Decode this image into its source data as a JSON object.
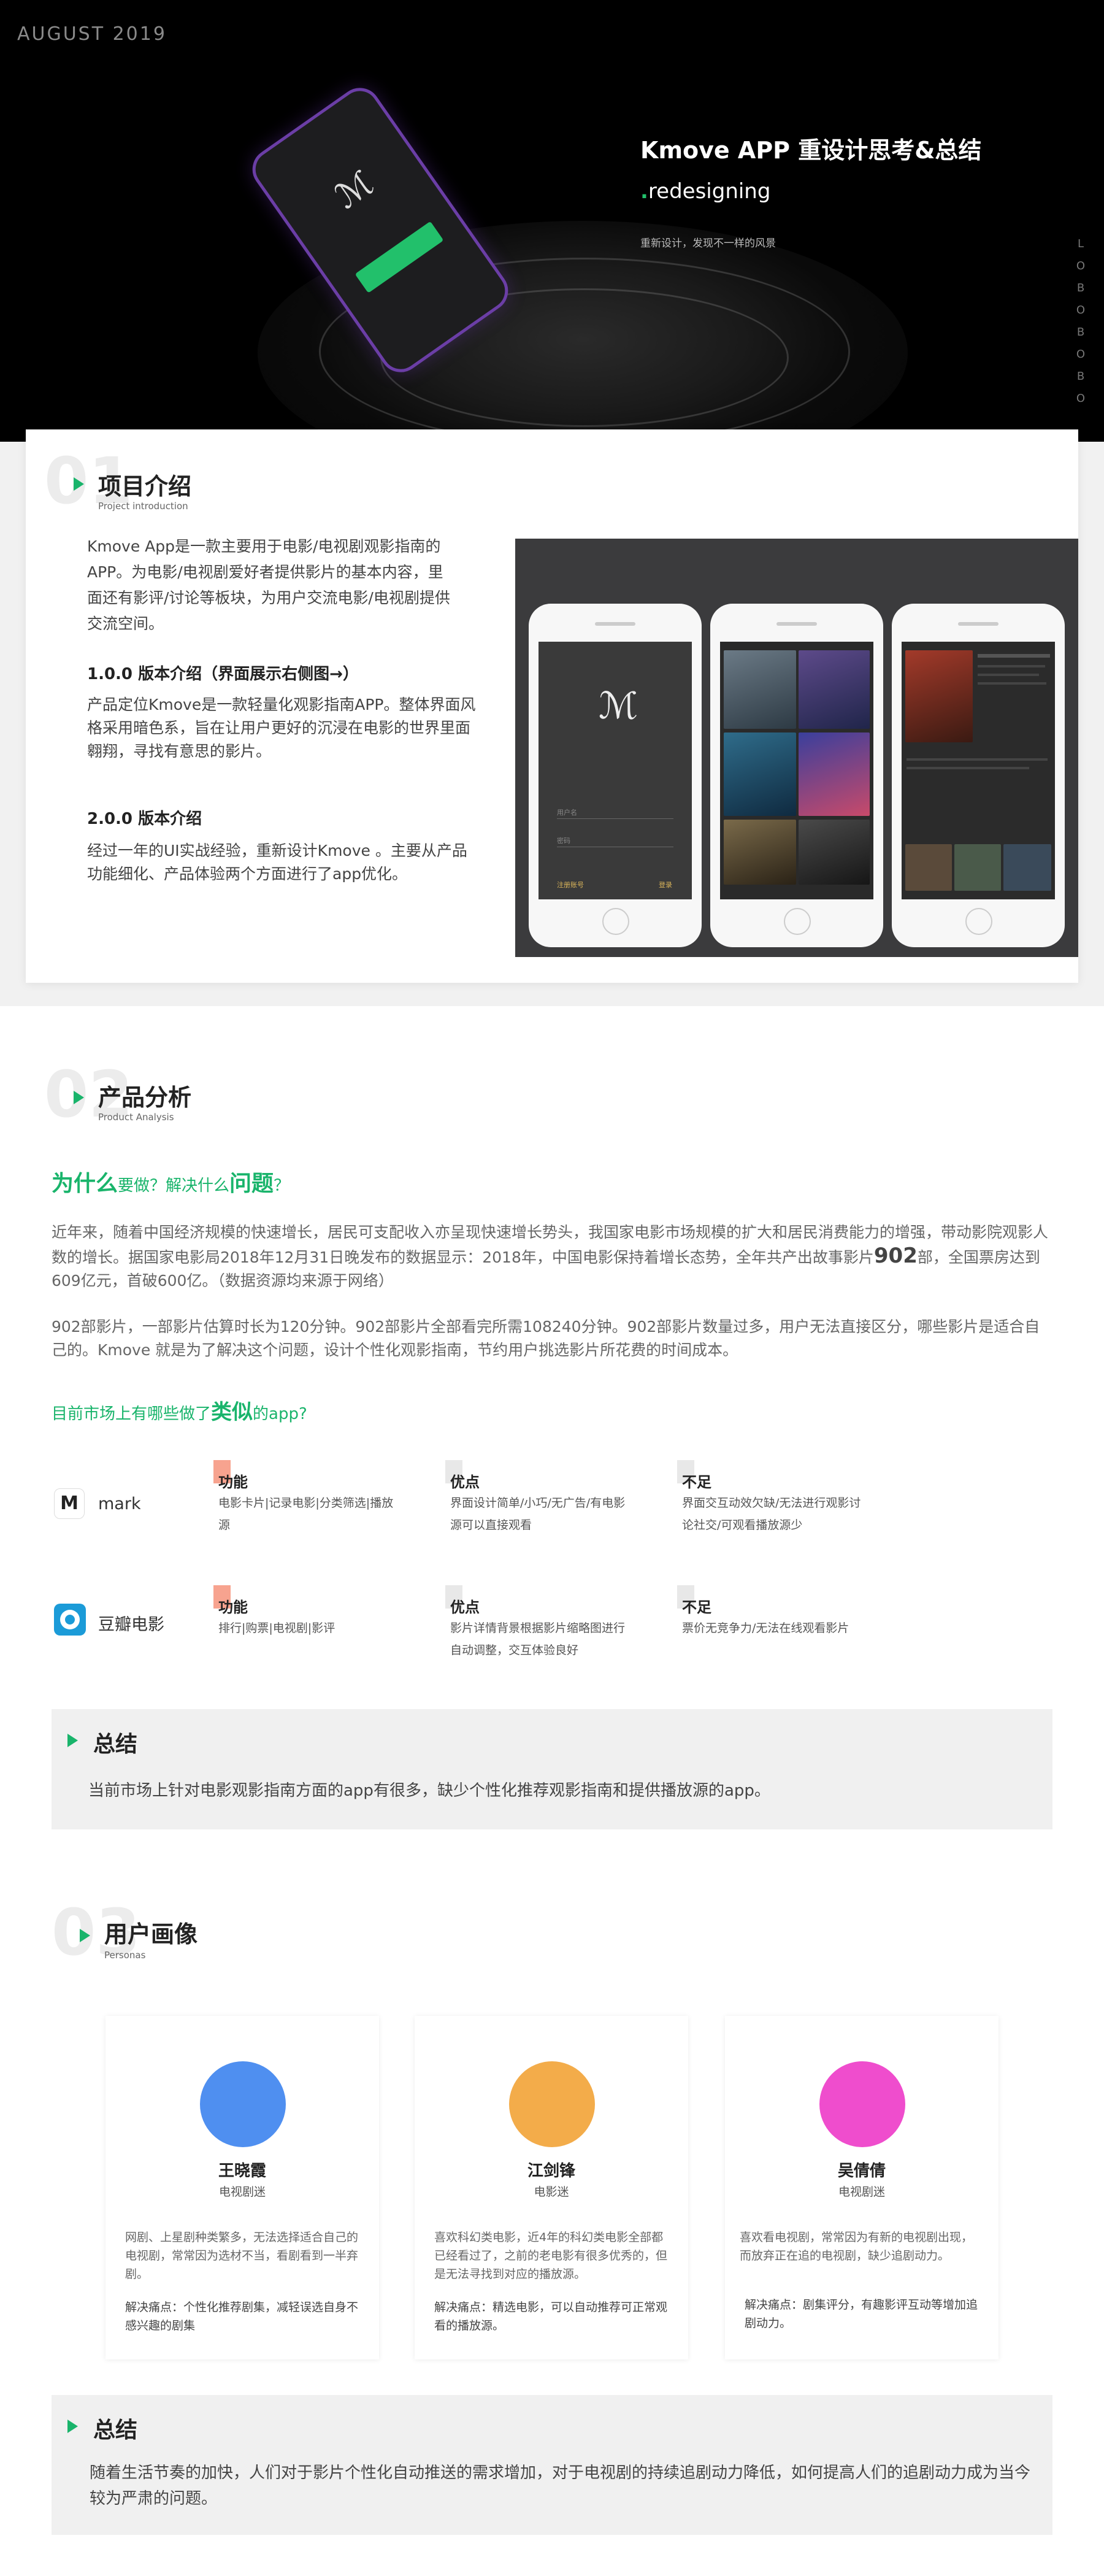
{
  "hero": {
    "date": "AUGUST  2019",
    "title": "Kmove APP 重设计思考&总结",
    "subtitle_dot": ".",
    "subtitle": "redesigning",
    "tagline": "重新设计，发现不一样的风景",
    "vertical_text": "LOBO BOBO"
  },
  "sec1": {
    "num": "01",
    "title": "项目介绍",
    "en": "Project  introduction",
    "intro": "Kmove  App是一款主要用于电影/电视剧观影指南的APP。为电影/电视剧爱好者提供影片的基本内容，里面还有影评/讨论等板块，为用户交流电影/电视剧提供交流空间。",
    "v1_title": "1.0.0 版本介绍（界面展示右侧图→）",
    "v1_text": "产品定位Kmove是一款轻量化观影指南APP。整体界面风格采用暗色系，旨在让用户更好的沉浸在电影的世界里面翱翔，寻找有意思的影片。",
    "v2_title": "2.0.0 版本介绍",
    "v2_text": "经过一年的UI实战经验，重新设计Kmove 。主要从产品功能细化、产品体验两个方面进行了app优化。",
    "phone1_login_placeholder": "用户名",
    "phone1_pwd_placeholder": "密码",
    "phone1_register": "注册账号",
    "phone1_login": "登录"
  },
  "sec2": {
    "num": "02",
    "title": "产品分析",
    "en": "Product Analysis",
    "q_big1": "为什么",
    "q_small1": "要做？解决",
    "q_small2": "什么",
    "q_big2": "问题",
    "q_small3": "？",
    "para1_a": "近年来，随着中国经济规模的快速增长，居民可支配收入亦呈现快速增长势头，我国家电影市场规模的扩大和居民消费能力的增强，带动影院观影人数的增长。据国家电影局2018年12月31日晚发布的数据显示：2018年，中国电影保持着增长态势，全年共产出故事影片",
    "para1_num": "902",
    "para1_b": "部，全国票房达到609亿元，首破600亿。（数据资源均来源于网络）",
    "para2": "902部影片，一部影片估算时长为120分钟。902部影片全部看完所需108240分钟。902部影片数量过多，用户无法直接区分，哪些影片是适合自己的。Kmove 就是为了解决这个问题，设计个性化观影指南，节约用户挑选影片所花费的时间成本。",
    "market_a": "目前市场上有哪些做了",
    "market_big": "类似",
    "market_b": "的app?",
    "apps": [
      {
        "name": "mark",
        "icon": "M",
        "func_title": "功能",
        "func_text": "电影卡片|记录电影|分类筛选|播放源",
        "pro_title": "优点",
        "pro_text": "界面设计简单/小巧/无广告/有电影源可以直接观看",
        "con_title": "不足",
        "con_text": "界面交互动效欠缺/无法进行观影讨论社交/可观看播放源少"
      },
      {
        "name": "豆瓣电影",
        "icon": "",
        "func_title": "功能",
        "func_text": "排行|购票|电视剧|影评",
        "pro_title": "优点",
        "pro_text": "影片详情背景根据影片缩略图进行自动调整，交互体验良好",
        "con_title": "不足",
        "con_text": "票价无竞争力/无法在线观看影片"
      }
    ],
    "summary_title": "总结",
    "summary_text": "当前市场上针对电影观影指南方面的app有很多，缺少个性化推荐观影指南和提供播放源的app。"
  },
  "sec3": {
    "num": "03",
    "title": "用户画像",
    "en": "Personas",
    "personas": [
      {
        "name": "王晓霞",
        "role": "电视剧迷",
        "color": "#4f8ff0",
        "desc": "网剧、上星剧种类繁多，无法选择适合自己的电视剧，常常因为选材不当，看剧看到一半弃剧。",
        "pain": "解决痛点：个性化推荐剧集，减轻误选自身不感兴趣的剧集"
      },
      {
        "name": "江剑锋",
        "role": "电影迷",
        "color": "#f3ac4a",
        "desc": "喜欢科幻类电影，近4年的科幻类电影全部都已经看过了，之前的老电影有很多优秀的，但是无法寻找到对应的播放源。",
        "pain": "解决痛点：精选电影，可以自动推荐可正常观看的播放源。"
      },
      {
        "name": "吴倩倩",
        "role": "电视剧迷",
        "color": "#ef4dcd",
        "desc": "喜欢看电视剧，常常因为有新的电视剧出现，而放弃正在追的电视剧，缺少追剧动力。",
        "pain": "解决痛点：剧集评分，有趣影评互动等增加追剧动力。"
      }
    ],
    "summary_title": "总结",
    "summary_text": "随着生活节奏的加快，人们对于影片个性化自动推送的需求增加，对于电视剧的持续追剧动力降低，如何提高人们的追剧动力成为当今较为严肃的问题。"
  }
}
